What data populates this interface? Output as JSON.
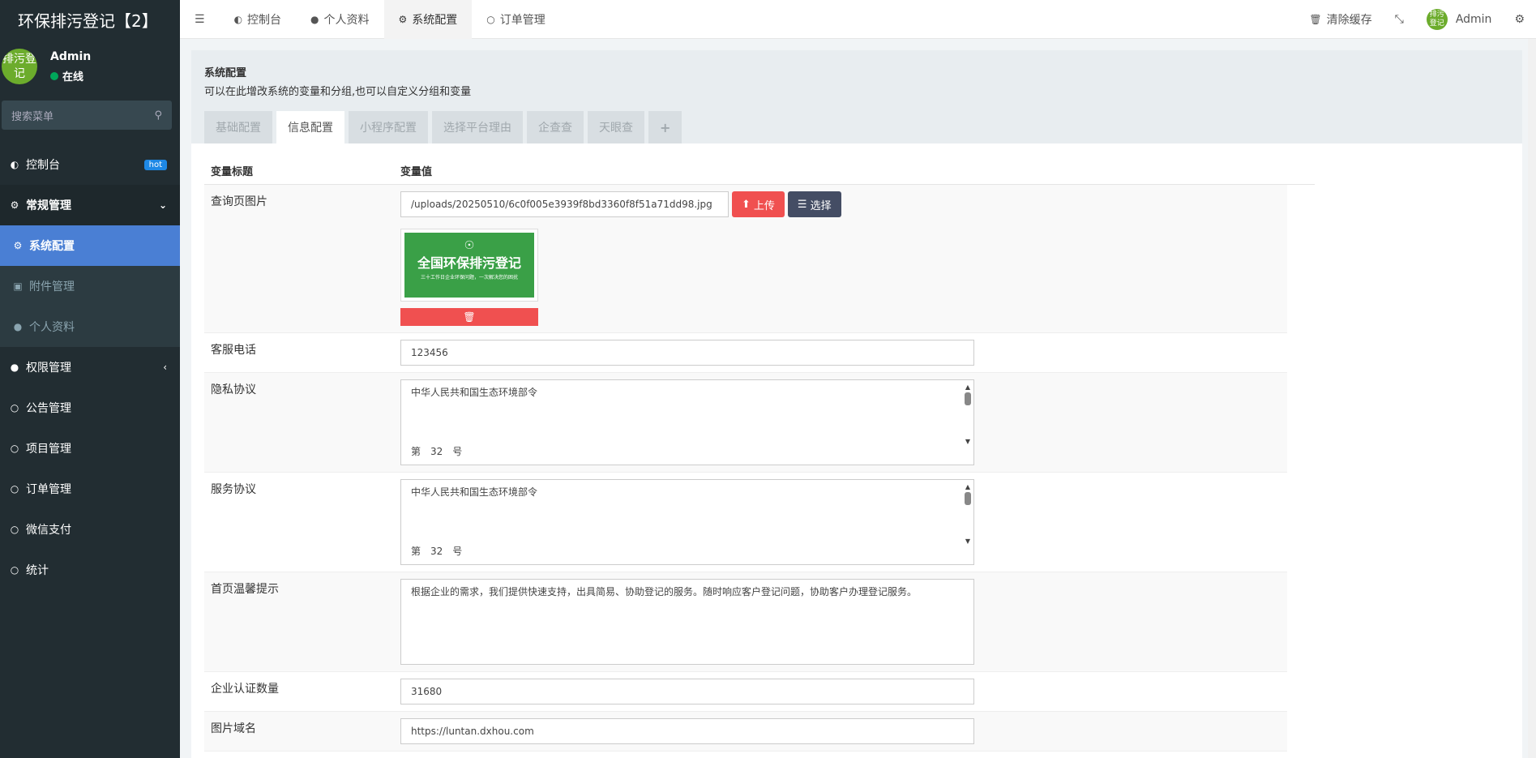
{
  "app": {
    "title": "环保排污登记【2】"
  },
  "user": {
    "name": "Admin",
    "status": "在线",
    "avatar_text": "排污登记"
  },
  "search": {
    "placeholder": "搜索菜单"
  },
  "sidebar": {
    "items": [
      {
        "label": "控制台",
        "icon": "dashboard-icon",
        "badge": "hot"
      },
      {
        "label": "常规管理",
        "icon": "cogs-icon"
      },
      {
        "label": "系统配置",
        "icon": "gear-icon"
      },
      {
        "label": "附件管理",
        "icon": "file-image-icon"
      },
      {
        "label": "个人资料",
        "icon": "user-icon"
      },
      {
        "label": "权限管理",
        "icon": "group-icon"
      },
      {
        "label": "公告管理",
        "icon": "circle-icon"
      },
      {
        "label": "项目管理",
        "icon": "circle-icon"
      },
      {
        "label": "订单管理",
        "icon": "circle-icon"
      },
      {
        "label": "微信支付",
        "icon": "circle-icon"
      },
      {
        "label": "统计",
        "icon": "circle-icon"
      }
    ]
  },
  "topbar": {
    "tabs": [
      {
        "label": "控制台",
        "icon": "dashboard-icon"
      },
      {
        "label": "个人资料",
        "icon": "user-icon"
      },
      {
        "label": "系统配置",
        "icon": "gear-icon"
      },
      {
        "label": "订单管理",
        "icon": "circle-icon"
      }
    ],
    "clear_cache": "清除缓存",
    "admin": "Admin"
  },
  "page": {
    "title": "系统配置",
    "description": "可以在此增改系统的变量和分组,也可以自定义分组和变量",
    "tabs": [
      "基础配置",
      "信息配置",
      "小程序配置",
      "选择平台理由",
      "企查查",
      "天眼查",
      "+"
    ],
    "col_title": "变量标题",
    "col_value": "变量值"
  },
  "fields": {
    "image": {
      "label": "查询页图片",
      "value": "/uploads/20250510/6c0f005e3939f8bd3360f8f51a71dd98.jpg",
      "upload": "上传",
      "choose": "选择",
      "thumb_title": "全国环保排污登记",
      "thumb_sub": "三十工作日企业环保问题，一次解决您的困扰"
    },
    "phone": {
      "label": "客服电话",
      "value": "123456"
    },
    "privacy": {
      "label": "隐私协议",
      "line1": "中华人民共和国生态环境部令",
      "line2": "第　32　号"
    },
    "service": {
      "label": "服务协议",
      "line1": "中华人民共和国生态环境部令",
      "line2": "第　32　号"
    },
    "tip": {
      "label": "首页温馨提示",
      "value": "根据企业的需求，我们提供快速支持，出具简易、协助登记的服务。随时响应客户登记问题，协助客户办理登记服务。"
    },
    "count": {
      "label": "企业认证数量",
      "value": "31680"
    },
    "domain": {
      "label": "图片域名",
      "value": "https://luntan.dxhou.com"
    }
  }
}
